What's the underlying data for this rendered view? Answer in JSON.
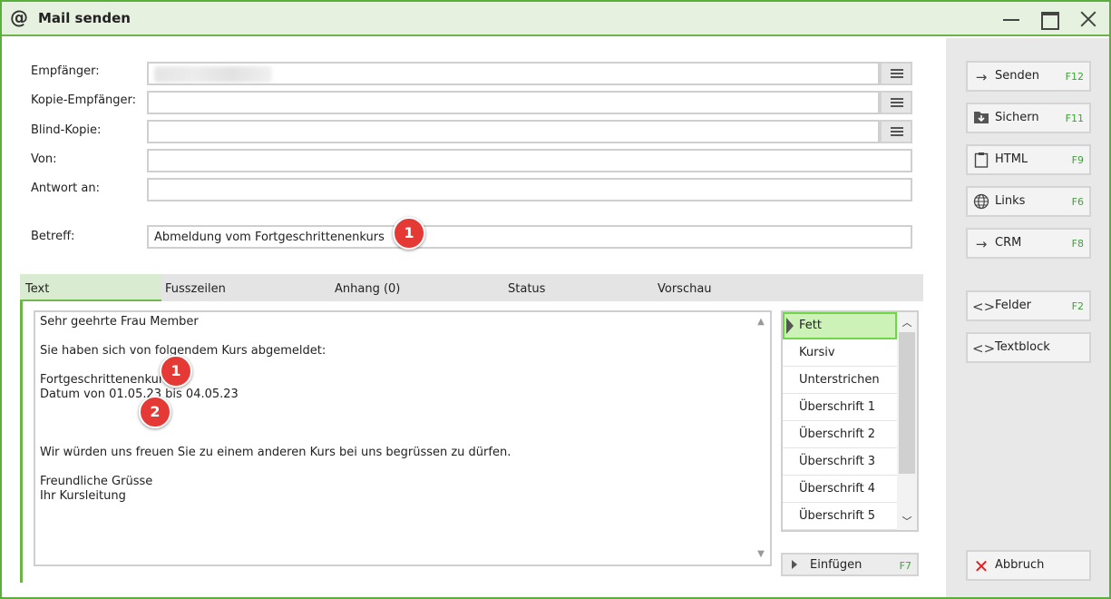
{
  "window": {
    "title": "Mail senden",
    "app_icon": "@"
  },
  "fields": {
    "recipient_label": "Empfänger:",
    "recipient_value": "",
    "cc_label": "Kopie-Empfänger:",
    "cc_value": "",
    "bcc_label": "Blind-Kopie:",
    "bcc_value": "",
    "from_label": "Von:",
    "from_value": "",
    "reply_to_label": "Antwort an:",
    "reply_to_value": "",
    "subject_label": "Betreff:",
    "subject_value": "Abmeldung vom Fortgeschrittenenkurs"
  },
  "badges": {
    "subject": "1",
    "body_course": "1",
    "body_date": "2"
  },
  "tabs": [
    {
      "label": "Text",
      "active": true
    },
    {
      "label": "Fusszeilen",
      "active": false
    },
    {
      "label": "Anhang (0)",
      "active": false
    },
    {
      "label": "Status",
      "active": false
    },
    {
      "label": "Vorschau",
      "active": false
    }
  ],
  "body_text": "Sehr geehrte Frau Member\n\nSie haben sich von folgendem Kurs abgemeldet:\n\nFortgeschrittenenkurs\nDatum von 01.05.23 bis 04.05.23\n\n\n\nWir würden uns freuen Sie zu einem anderen Kurs bei uns begrüssen zu dürfen.\n\nFreundliche Grüsse\nIhr Kursleitung",
  "format_list": {
    "items": [
      "Fett",
      "Kursiv",
      "Unterstrichen",
      "Überschrift 1",
      "Überschrift 2",
      "Überschrift 3",
      "Überschrift 4",
      "Überschrift 5"
    ],
    "selected": "Fett"
  },
  "insert_button": {
    "label": "Einfügen",
    "shortcut": "F7"
  },
  "side_buttons": [
    {
      "label": "Senden",
      "shortcut": "F12",
      "icon": "arrow-right-icon"
    },
    {
      "label": "Sichern",
      "shortcut": "F11",
      "icon": "save-folder-icon"
    },
    {
      "label": "HTML",
      "shortcut": "F9",
      "icon": "clipboard-icon"
    },
    {
      "label": "Links",
      "shortcut": "F6",
      "icon": "globe-icon"
    },
    {
      "label": "CRM",
      "shortcut": "F8",
      "icon": "arrow-right-icon"
    },
    {
      "label": "Felder",
      "shortcut": "F2",
      "icon": "code-brackets-icon"
    },
    {
      "label": "Textblock",
      "shortcut": "",
      "icon": "code-brackets-icon"
    },
    {
      "label": "Abbruch",
      "shortcut": "",
      "icon": "close-x-icon"
    }
  ],
  "colors": {
    "accent_green": "#5aae3c",
    "badge_red": "#e53935",
    "shortcut_green": "#3aa533",
    "close_red": "#e02020"
  }
}
